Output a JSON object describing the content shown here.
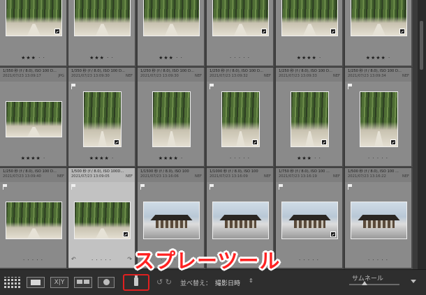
{
  "grid": {
    "row1": {
      "cells": [
        {
          "stars": "★★★ · ·",
          "thumb": "forest",
          "badge": true
        },
        {
          "stars": "★★★ · ·",
          "thumb": "forest",
          "badge": false
        },
        {
          "stars": "★★★ · ·",
          "thumb": "forest",
          "badge": false
        },
        {
          "stars": "· · · · ·",
          "thumb": "forest",
          "badge": true
        },
        {
          "stars": "★★★★ ·",
          "thumb": "forest",
          "badge": true
        },
        {
          "stars": "★★★★ ·",
          "thumb": "forest",
          "badge": true
        }
      ]
    },
    "row2": {
      "cells": [
        {
          "line1": "1/350 秒 (f / 8.0), ISO 100 D...",
          "date": "2021/07/23 13:09:17",
          "ext": "JPG",
          "thumb": "forest",
          "orientation": "landscape",
          "badge": false,
          "stars": "★★★★ ·",
          "flag": false
        },
        {
          "line1": "1/350 秒 (f / 8.0), ISO 100 D...",
          "date": "2021/07/23 13:09:30",
          "ext": "NEF",
          "thumb": "forest",
          "orientation": "portrait",
          "badge": true,
          "stars": "★★★★ ·",
          "flag": true
        },
        {
          "line1": "1/250 秒 (f / 8.0), ISO 100 D...",
          "date": "2021/07/23 13:09:30",
          "ext": "NEF",
          "thumb": "forest",
          "orientation": "portrait",
          "badge": false,
          "stars": "★★★★ ·",
          "flag": false
        },
        {
          "line1": "1/250 秒 (f / 8.0), ISO 100 D...",
          "date": "2021/07/23 13:09:32",
          "ext": "NEF",
          "thumb": "forest",
          "orientation": "portrait",
          "badge": true,
          "stars": "· · · · ·",
          "flag": true
        },
        {
          "line1": "1/250 秒 (f / 8.0), ISO 100 D...",
          "date": "2021/07/23 13:09:33",
          "ext": "NEF",
          "thumb": "forest",
          "orientation": "portrait",
          "badge": true,
          "stars": "★★★ · ·",
          "flag": false
        },
        {
          "line1": "1/250 秒 (f / 8.0), ISO 100 D...",
          "date": "2021/07/23 13:09:34",
          "ext": "NEF",
          "thumb": "forest",
          "orientation": "portrait",
          "badge": true,
          "stars": "· · · · ·",
          "flag": true
        }
      ]
    },
    "row3": {
      "cells": [
        {
          "line1": "1/250 秒 (f / 8.0), ISO 100 D...",
          "date": "2021/07/23 13:09:40",
          "ext": "NEF",
          "thumb": "forest",
          "badge": false,
          "selected": false
        },
        {
          "line1": "1/500 秒 (f / 8.0), ISO 100D...",
          "date": "2021/07/23 13:09:05",
          "ext": "NEF",
          "thumb": "forest",
          "badge": true,
          "selected": true
        },
        {
          "line1": "1/1500 秒 (f / 8.0), ISO 100",
          "date": "2021/07/23 13:16:06",
          "ext": "NEF",
          "thumb": "temple",
          "badge": false,
          "selected": false
        },
        {
          "line1": "1/1000 秒 (f / 8.0), ISO 100",
          "date": "2021/07/23 13:16:09",
          "ext": "NEF",
          "thumb": "temple",
          "badge": false,
          "selected": false
        },
        {
          "line1": "1/750 秒 (f / 8.0), ISO 100 ...",
          "date": "2021/07/23 13:16:19",
          "ext": "NEF",
          "thumb": "temple",
          "badge": true,
          "selected": false
        },
        {
          "line1": "1/500 秒 (f / 8.0), ISO 100 ...",
          "date": "2021/07/23 13:16:22",
          "ext": "NEF",
          "thumb": "temple",
          "badge": false,
          "selected": false
        }
      ],
      "stars": "· · · · ·"
    }
  },
  "toolbar": {
    "xy_label": "X|Y",
    "rotate_icons": "↺ ↻",
    "sort_label": "並べ替え：",
    "sort_value": "撮影日時",
    "sort_arrows": "⇕",
    "thumbnail_label": "サムネール"
  },
  "annotation": {
    "label": "スプレーツール",
    "color": "#ff2222"
  }
}
